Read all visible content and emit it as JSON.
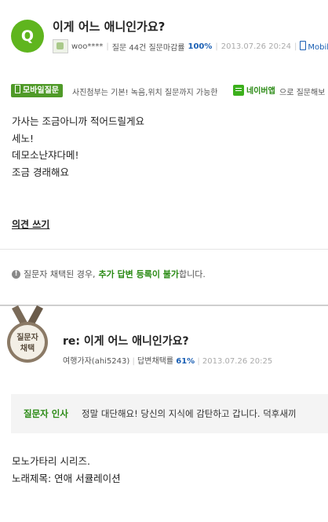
{
  "question": {
    "badge": "Q",
    "title": "이게 어느 애니인가요?",
    "author": "woo****",
    "stats_prefix": "질문 44건 질문마감률",
    "close_rate": "100%",
    "date": "2013.07.26 20:24",
    "source": "Mobile"
  },
  "banner": {
    "badge": "모바일질문",
    "text": "사진첨부는 기본! 녹음,위치 질문까지 가능한",
    "app_label": "네이버앱",
    "text2": "으로 질문해보"
  },
  "body": {
    "lines": [
      "가사는 조금아니까 적어드릴게요",
      "세노!",
      "데모소난쟈다메!",
      "조금 경래해요"
    ]
  },
  "write_opinion": "의견 쓰기",
  "notice": {
    "icon": "!",
    "prefix": "질문자 채택된 경우,",
    "highlight": "추가 답변 등록이 불가",
    "suffix": "합니다."
  },
  "answer": {
    "medal_line1": "질문자",
    "medal_line2": "채택",
    "title": "re: 이게 어느 애니인가요?",
    "author": "여행가자(ahi5243)",
    "stats_prefix": "답변채택률",
    "select_rate": "61%",
    "date": "2013.07.26 20:25",
    "greeting_label": "질문자 인사",
    "greeting_text": "정말 대단해요! 당신의 지식에 감탄하고 갑니다. 덕후새끼",
    "lines": [
      "모노가타리 시리즈.",
      "노래제목: 연애 서큘레이션"
    ]
  },
  "colors": {
    "accent_green": "#5fb51e",
    "link_blue": "#1a5fb4",
    "medal_brown": "#8b7a66"
  }
}
